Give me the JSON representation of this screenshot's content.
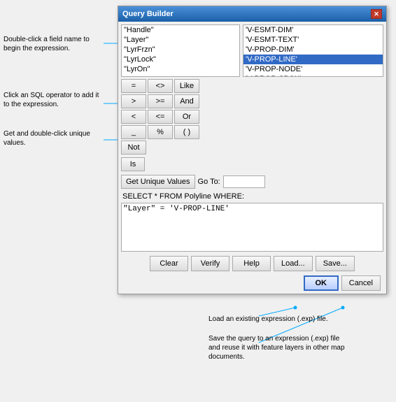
{
  "annotations": {
    "label1": "Double-click a field name to begin the expression.",
    "label2": "Click an SQL operator to add it to the expression.",
    "label3": "Get and double-click unique values.",
    "label4_load": "Load an existing expression (.exp) file.",
    "label5_save": "Save the query to an expression (.exp) file and reuse it with feature layers in other map documents."
  },
  "dialog": {
    "title": "Query Builder",
    "close": "✕",
    "fields_list": [
      "\"Handle\"",
      "\"Layer\"",
      "\"LyrFrzn\"",
      "\"LyrLock\"",
      "\"LyrOn\""
    ],
    "values_list": [
      "'V-ESMT-DIM'",
      "'V-ESMT-TEXT'",
      "'V-PROP-DIM'",
      "'V-PROP-LINE'",
      "'V-PROP-NODE'",
      "'V-PROP-SBCK'"
    ],
    "selected_value_index": 3,
    "operators": [
      "=",
      "<>",
      "Like",
      ">",
      ">=",
      "And",
      "<",
      "<=",
      "Or",
      "_",
      "%",
      "()",
      "Not"
    ],
    "is_btn": "Is",
    "get_unique_btn": "Get Unique Values",
    "goto_label": "Go To:",
    "goto_value": "",
    "where_label": "SELECT * FROM Polyline WHERE:",
    "expression": "\"Layer\" = 'V-PROP-LINE'",
    "clear_btn": "Clear",
    "verify_btn": "Verify",
    "help_btn": "Help",
    "load_btn": "Load...",
    "save_btn": "Save...",
    "ok_btn": "OK",
    "cancel_btn": "Cancel"
  }
}
